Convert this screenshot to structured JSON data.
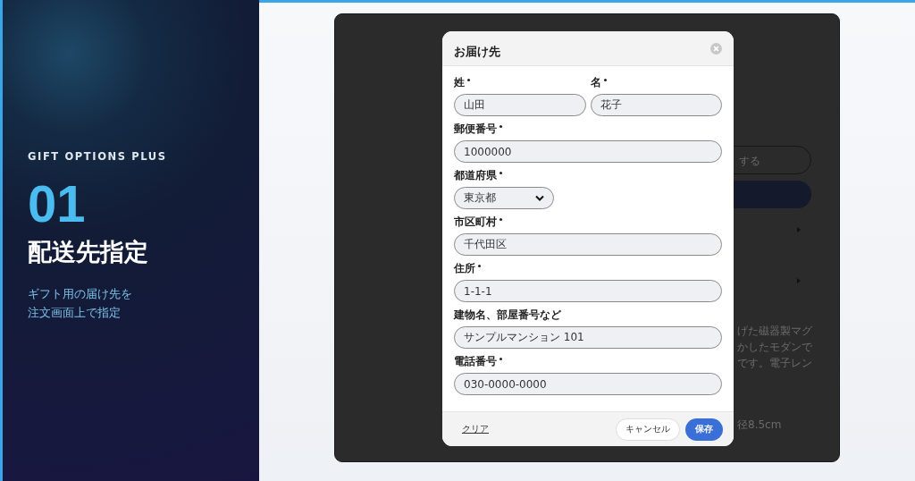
{
  "hero": {
    "brand": "GIFT OPTIONS PLUS",
    "number": "01",
    "title": "配送先指定",
    "subtitle_lines": [
      "ギフト用の届け先を",
      "注文画面上で指定"
    ]
  },
  "background_page": {
    "button_text": "する",
    "description_lines": [
      "げた磁器製マグ",
      "かしたモダンで",
      "です。電子レン"
    ],
    "size_text": "径8.5cm"
  },
  "dialog": {
    "title": "お届け先",
    "rows": [
      {
        "fields": [
          {
            "label": "姓",
            "required": true,
            "kind": "text",
            "value": "山田"
          },
          {
            "label": "名",
            "required": true,
            "kind": "text",
            "value": "花子"
          }
        ]
      },
      {
        "fields": [
          {
            "label": "郵便番号",
            "required": true,
            "kind": "text",
            "value": "1000000"
          }
        ]
      },
      {
        "fields": [
          {
            "label": "都道府県",
            "required": true,
            "kind": "select",
            "value": "東京都"
          }
        ]
      },
      {
        "fields": [
          {
            "label": "市区町村",
            "required": true,
            "kind": "text",
            "value": "千代田区"
          }
        ]
      },
      {
        "fields": [
          {
            "label": "住所",
            "required": true,
            "kind": "text",
            "value": "1-1-1"
          }
        ]
      },
      {
        "fields": [
          {
            "label": "建物名、部屋番号など",
            "required": false,
            "kind": "text",
            "value": "サンプルマンション 101"
          }
        ]
      },
      {
        "fields": [
          {
            "label": "電話番号",
            "required": true,
            "kind": "text",
            "value": "030-0000-0000"
          }
        ]
      }
    ],
    "clear_link": "クリア",
    "cancel_button": "キャンセル",
    "save_button": "保存"
  }
}
